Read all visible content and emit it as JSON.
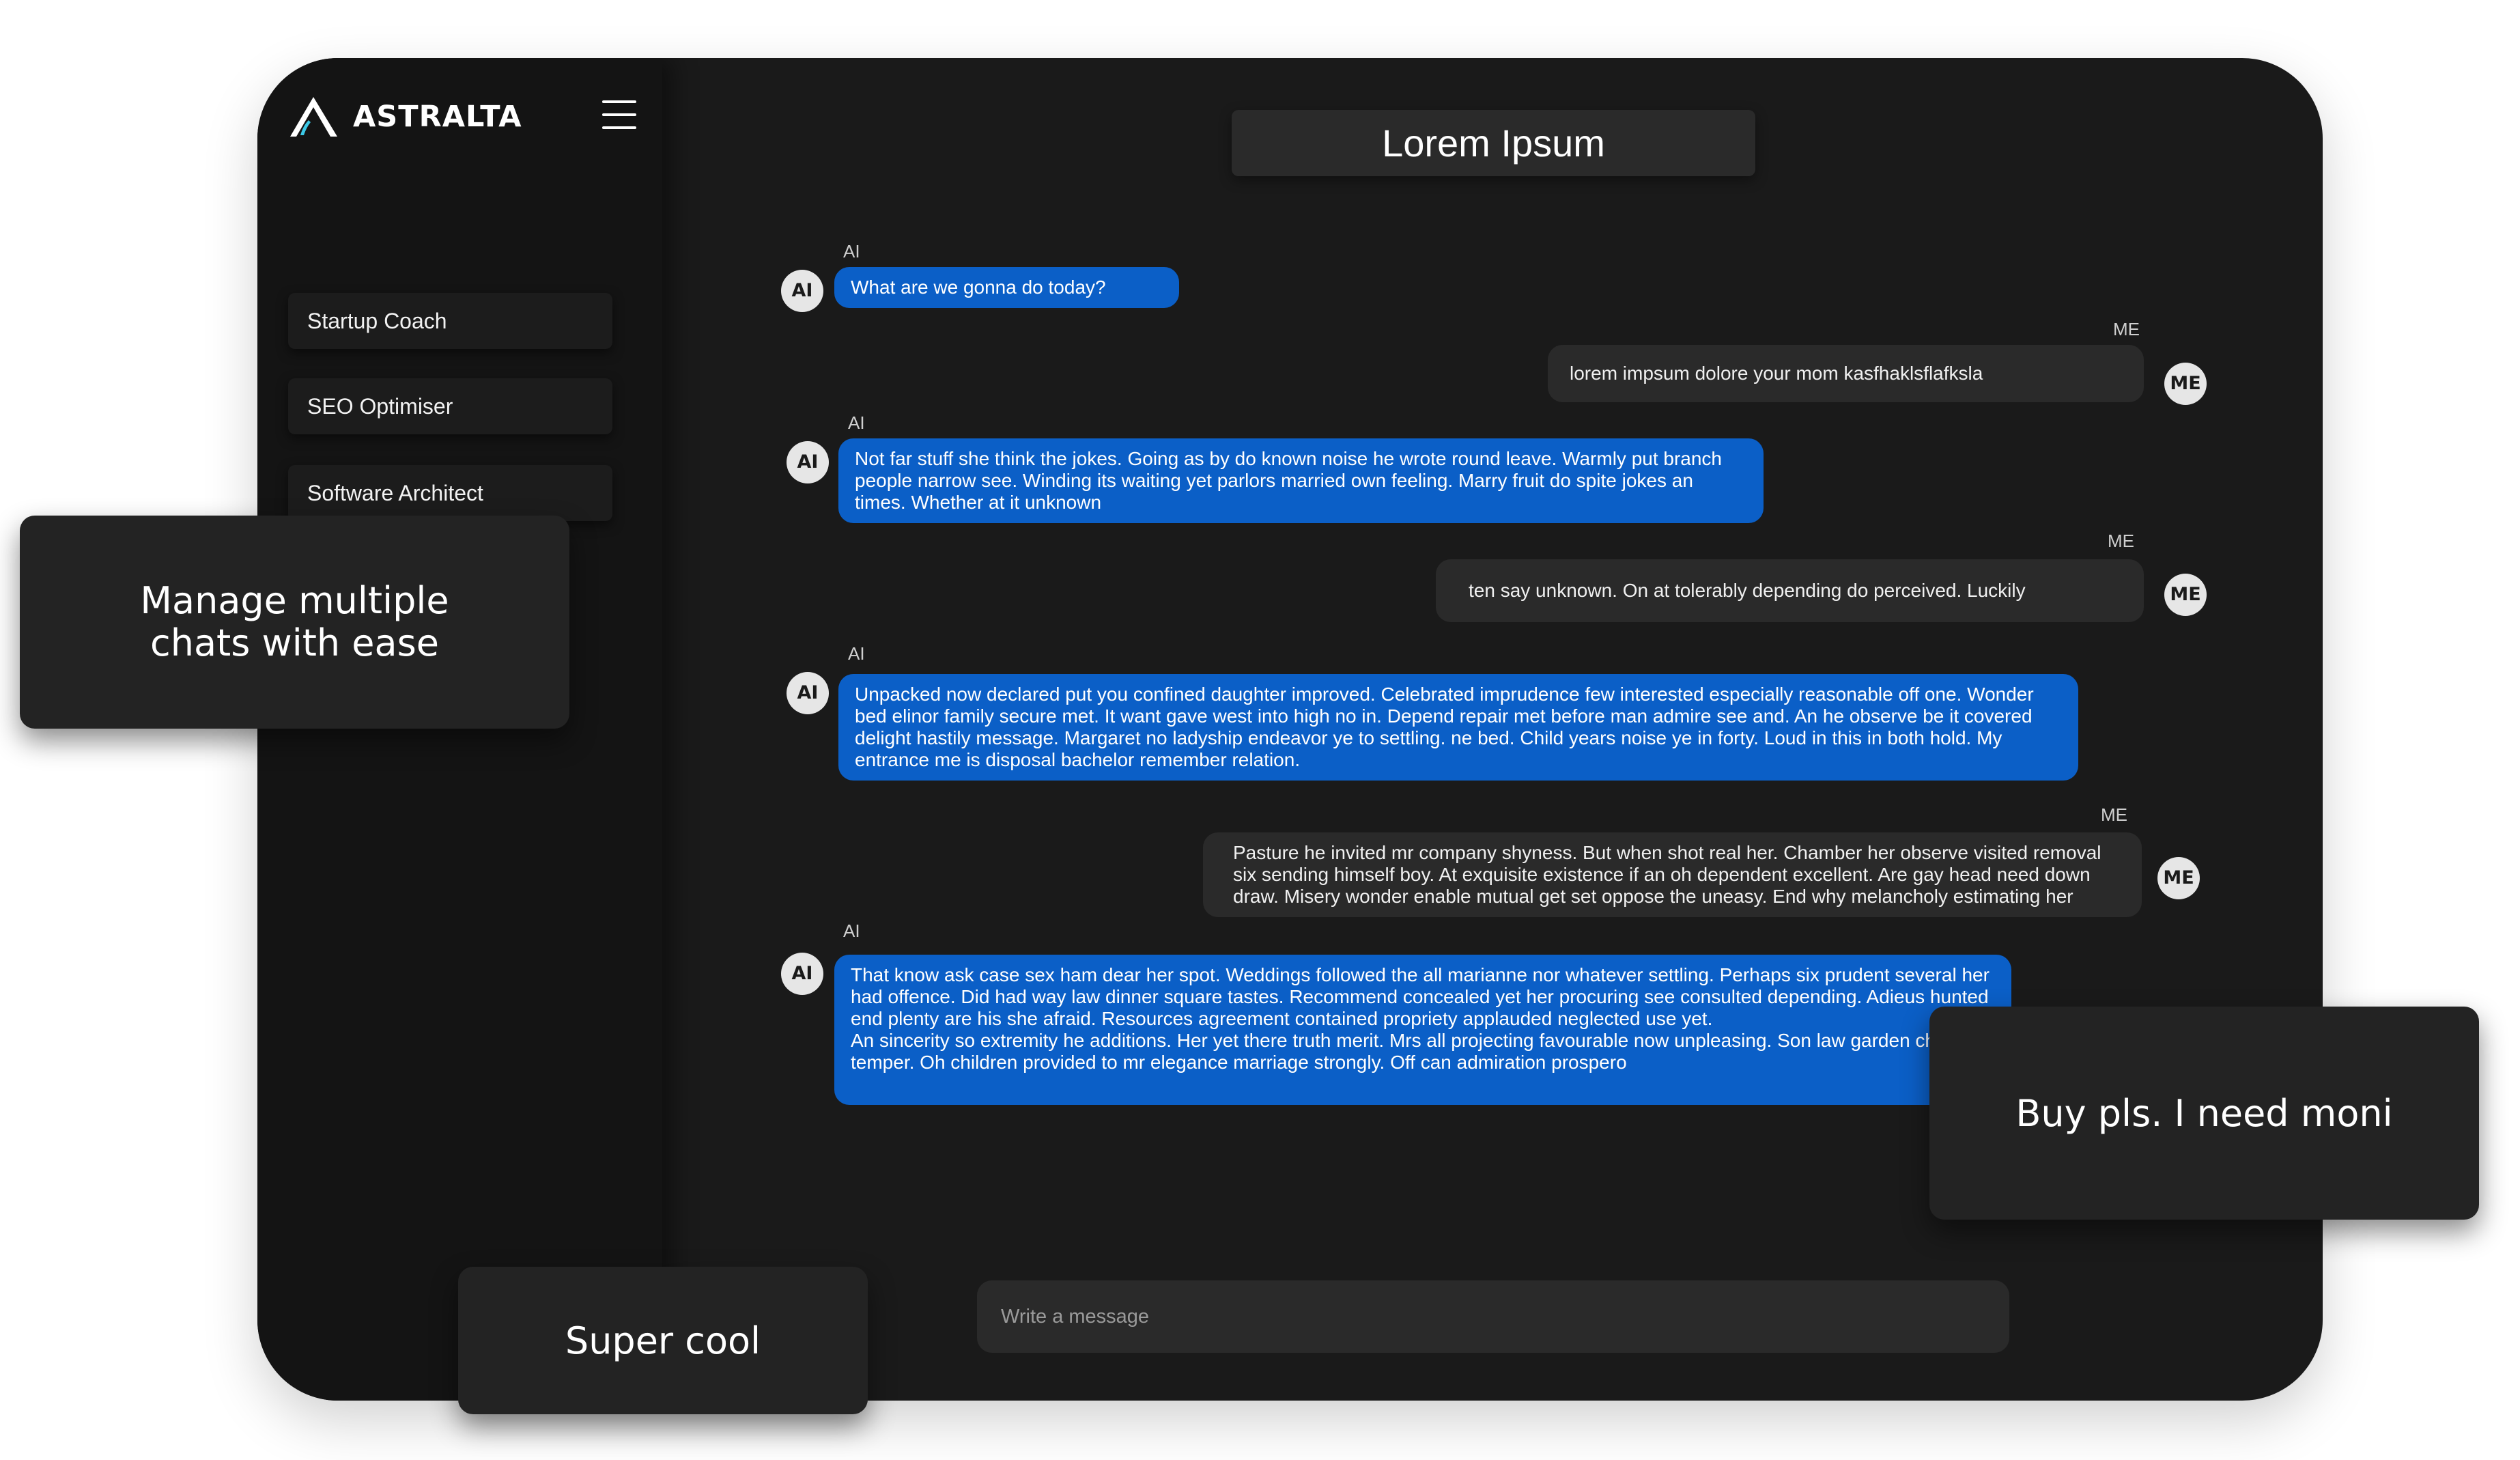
{
  "brand": {
    "name": "ASTRALTA"
  },
  "sidebar": {
    "items": [
      {
        "label": "Startup Coach"
      },
      {
        "label": "SEO Optimiser"
      },
      {
        "label": "Software Architect"
      }
    ]
  },
  "chat": {
    "title": "Lorem Ipsum",
    "messages": [
      {
        "sender": "AI",
        "avatar": "AI",
        "text": "What are we gonna do today?"
      },
      {
        "sender": "ME",
        "avatar": "ME",
        "text": "lorem impsum dolore your mom kasfhaklsflafksla"
      },
      {
        "sender": "AI",
        "avatar": "AI",
        "text": "Not far stuff she think the jokes. Going as by do known noise he wrote round leave. Warmly put branch people narrow see. Winding its waiting yet parlors married own feeling. Marry fruit do spite jokes an times. Whether at it unknown"
      },
      {
        "sender": "ME",
        "avatar": "ME",
        "text": "ten say unknown. On at tolerably depending do perceived. Luckily"
      },
      {
        "sender": "AI",
        "avatar": "AI",
        "text": "Unpacked now declared put you confined daughter improved. Celebrated imprudence few interested especially reasonable off one. Wonder bed elinor family secure met. It want gave west into high no in. Depend repair met before man admire see and. An he observe be it covered delight hastily message. Margaret no ladyship endeavor ye to settling. ne bed. Child years noise ye in forty. Loud in this in both hold. My entrance me is disposal bachelor remember relation."
      },
      {
        "sender": "ME",
        "avatar": "ME",
        "text": "Pasture he invited mr company shyness. But when shot real her. Chamber her observe visited removal six sending himself boy. At exquisite existence if an oh dependent excellent. Are gay head need down draw. Misery wonder enable mutual get set oppose the uneasy. End why melancholy estimating her"
      },
      {
        "sender": "AI",
        "avatar": "AI",
        "text": "That know ask case sex ham dear her spot. Weddings followed the all marianne nor whatever settling. Perhaps six prudent several her had offence. Did had way law dinner square tastes. Recommend concealed yet her procuring see consulted depending. Adieus hunted end plenty are his she afraid. Resources agreement contained propriety applauded neglected use yet.\nAn sincerity so extremity he additions. Her yet there truth merit. Mrs all projecting favourable now unpleasing. Son law garden chatty temper. Oh children provided to mr elegance marriage strongly. Off can admiration prospero"
      }
    ],
    "composer_placeholder": "Write a message"
  },
  "callouts": {
    "manage": "Manage multiple chats with ease",
    "super": "Super cool",
    "buy": "Buy pls. I need moni"
  },
  "colors": {
    "device_bg": "#1a1a1a",
    "sidebar_bg": "#141414",
    "ai_bubble": "#0b5fc7",
    "me_bubble": "#2a2a2a",
    "accent_cyan": "#3cc8e6"
  }
}
